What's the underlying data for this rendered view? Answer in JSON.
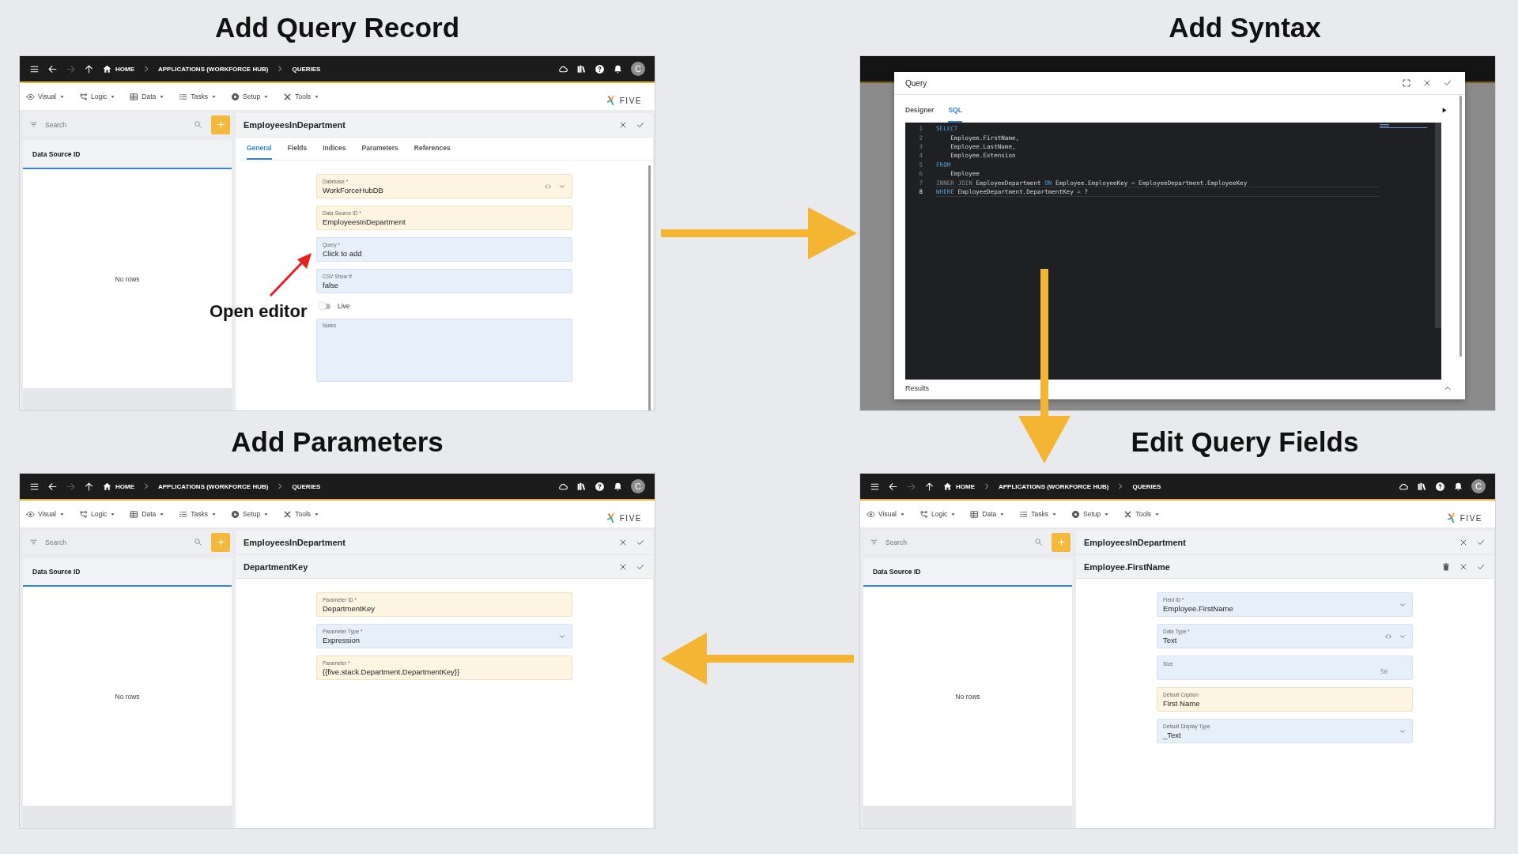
{
  "panels": [
    {
      "kind": "record",
      "title": "Add Query Record",
      "app": {
        "breadcrumbs": [
          "HOME",
          "APPLICATIONS (WORKFORCE HUB)",
          "QUERIES"
        ],
        "avatar": "C",
        "menus": [
          "Visual",
          "Logic",
          "Data",
          "Tasks",
          "Setup",
          "Tools"
        ],
        "logo": "FIVE",
        "search_placeholder": "Search",
        "list_header": "Data Source ID",
        "empty_text": "No rows"
      },
      "record": {
        "title": "EmployeesInDepartment",
        "tabs": [
          {
            "label": "General",
            "selected": true
          },
          {
            "label": "Fields",
            "selected": false
          },
          {
            "label": "Indices",
            "selected": false
          },
          {
            "label": "Parameters",
            "selected": false
          },
          {
            "label": "References",
            "selected": false
          }
        ],
        "fields": [
          {
            "label": "Database *",
            "value": "WorkForceHubDB",
            "modified": true,
            "code": true,
            "dropdown": true,
            "numeric": false
          },
          {
            "label": "Data Source ID *",
            "value": "EmployeesInDepartment",
            "modified": true,
            "code": false,
            "dropdown": false,
            "numeric": false
          },
          {
            "label": "Query *",
            "value": "Click to add",
            "modified": false,
            "code": false,
            "dropdown": false,
            "numeric": false
          },
          {
            "label": "CSV Show If",
            "value": "false",
            "modified": false,
            "code": false,
            "dropdown": false,
            "numeric": false
          }
        ],
        "toggle": {
          "label": "Live",
          "on": false
        },
        "notes": {
          "label": "Notes"
        }
      },
      "annotation": "Open editor"
    },
    {
      "kind": "editor",
      "title": "Add Syntax",
      "dialog": {
        "title": "Query",
        "tabs": [
          {
            "label": "Designer",
            "selected": false
          },
          {
            "label": "SQL",
            "selected": true
          }
        ],
        "lines": [
          {
            "number": "1",
            "current": false,
            "segments": [
              {
                "text": "SELECT",
                "kind": "keyword"
              }
            ]
          },
          {
            "number": "2",
            "current": false,
            "segments": [
              {
                "text": "    Employee.FirstName,",
                "kind": "plain"
              }
            ]
          },
          {
            "number": "3",
            "current": false,
            "segments": [
              {
                "text": "    Employee.LastName,",
                "kind": "plain"
              }
            ]
          },
          {
            "number": "4",
            "current": false,
            "segments": [
              {
                "text": "    Employee.Extension",
                "kind": "plain"
              }
            ]
          },
          {
            "number": "5",
            "current": false,
            "segments": [
              {
                "text": "FROM",
                "kind": "keyword"
              }
            ]
          },
          {
            "number": "6",
            "current": false,
            "segments": [
              {
                "text": "    Employee",
                "kind": "plain"
              }
            ]
          },
          {
            "number": "7",
            "current": false,
            "segments": [
              {
                "text": "INNER JOIN",
                "kind": "dim"
              },
              {
                "text": " EmployeeDepartment ",
                "kind": "plain"
              },
              {
                "text": "ON",
                "kind": "keyword"
              },
              {
                "text": " Employee.EmployeeKey ",
                "kind": "plain"
              },
              {
                "text": "=",
                "kind": "dim"
              },
              {
                "text": " EmployeeDepartment.EmployeeKey",
                "kind": "plain"
              }
            ]
          },
          {
            "number": "8",
            "current": true,
            "segments": [
              {
                "text": "WHERE",
                "kind": "keyword"
              },
              {
                "text": " EmployeeDepartment.DepartmentKey ",
                "kind": "plain"
              },
              {
                "text": "=",
                "kind": "dim"
              },
              {
                "text": " ?",
                "kind": "plain"
              }
            ]
          }
        ],
        "results_label": "Results"
      }
    },
    {
      "kind": "detail",
      "title": "Add Parameters",
      "app": {
        "breadcrumbs": [
          "HOME",
          "APPLICATIONS (WORKFORCE HUB)",
          "QUERIES"
        ],
        "avatar": "C",
        "menus": [
          "Visual",
          "Logic",
          "Data",
          "Tasks",
          "Setup",
          "Tools"
        ],
        "logo": "FIVE",
        "search_placeholder": "Search",
        "list_header": "Data Source ID",
        "empty_text": "No rows"
      },
      "record": {
        "title": "EmployeesInDepartment",
        "subrecord": {
          "title": "DepartmentKey",
          "deletable": false
        },
        "fields": [
          {
            "label": "Parameter ID *",
            "value": "DepartmentKey",
            "modified": true,
            "code": false,
            "dropdown": false,
            "numeric": false
          },
          {
            "label": "Parameter Type *",
            "value": "Expression",
            "modified": false,
            "code": false,
            "dropdown": true,
            "numeric": false
          },
          {
            "label": "Parameter *",
            "value": "{{five.stack.Department.DepartmentKey}}",
            "modified": true,
            "code": false,
            "dropdown": false,
            "numeric": false
          }
        ]
      }
    },
    {
      "kind": "detail",
      "title": "Edit Query Fields",
      "app": {
        "breadcrumbs": [
          "HOME",
          "APPLICATIONS (WORKFORCE HUB)",
          "QUERIES"
        ],
        "avatar": "C",
        "menus": [
          "Visual",
          "Logic",
          "Data",
          "Tasks",
          "Setup",
          "Tools"
        ],
        "logo": "FIVE",
        "search_placeholder": "Search",
        "list_header": "Data Source ID",
        "empty_text": "No rows"
      },
      "record": {
        "title": "EmployeesInDepartment",
        "subrecord": {
          "title": "Employee.FirstName",
          "deletable": true
        },
        "fields": [
          {
            "label": "Field ID *",
            "value": "Employee.FirstName",
            "modified": false,
            "code": false,
            "dropdown": true,
            "numeric": false
          },
          {
            "label": "Data Type *",
            "value": "Text",
            "modified": false,
            "code": true,
            "dropdown": true,
            "numeric": false
          },
          {
            "label": "Size",
            "value": "50",
            "modified": false,
            "code": false,
            "dropdown": false,
            "numeric": true
          },
          {
            "label": "Default Caption",
            "value": "First Name",
            "modified": true,
            "code": false,
            "dropdown": false,
            "numeric": false
          },
          {
            "label": "Default Display Type",
            "value": "_Text",
            "modified": false,
            "code": false,
            "dropdown": true,
            "numeric": false
          }
        ]
      }
    }
  ]
}
